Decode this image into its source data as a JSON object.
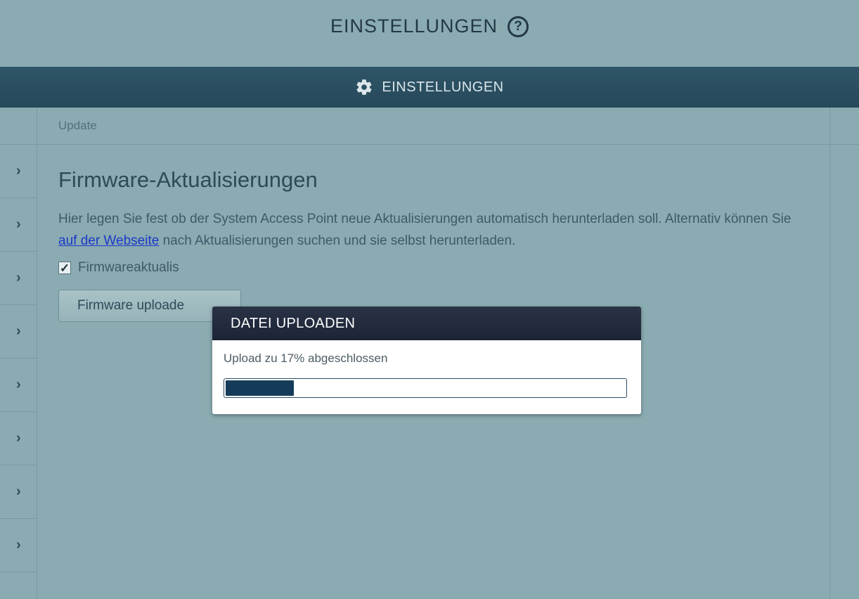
{
  "topbar": {
    "title": "EINSTELLUNGEN",
    "help_icon": "question-circle-icon",
    "help_glyph": "?"
  },
  "navbar": {
    "title": "EINSTELLUNGEN",
    "icon": "gear-icon"
  },
  "breadcrumb": "Update",
  "sidebar": {
    "chevron": "›",
    "item_count": 8
  },
  "main": {
    "heading": "Firmware-Aktualisierungen",
    "description_part1": "Hier legen Sie fest ob der System Access Point neue Aktualisierungen automatisch herunterladen soll. Alternativ können Sie ",
    "description_link": "auf der Webseite",
    "description_part2": " nach Aktualisierungen suchen und sie selbst herunterladen.",
    "checkbox_label": "Firmwareaktualis",
    "checkbox_checked": true,
    "checkbox_mark": "✓",
    "upload_button_label": "Firmware uploade"
  },
  "dialog": {
    "title": "DATEI UPLOADEN",
    "status": "Upload zu 17% abgeschlossen",
    "progress_percent": 17
  },
  "colors": {
    "background": "#8aabb1",
    "navbar": "#26495a",
    "dialog_header": "#1c2436",
    "progress_fill": "#143c5a",
    "link": "#1b38c8"
  }
}
